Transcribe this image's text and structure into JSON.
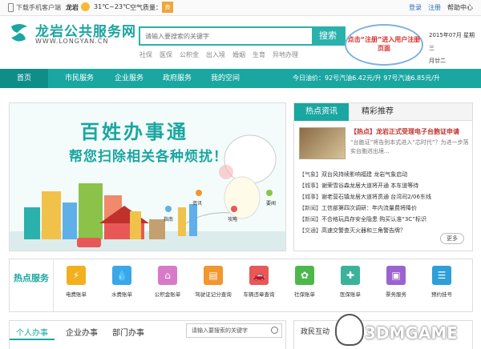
{
  "topbar": {
    "mobile": "下载手机客户端",
    "city": "龙岩",
    "temp": "31℃~23℃",
    "aq_label": "空气质量：",
    "aq_value": "良",
    "links": [
      "登录",
      "注册",
      "帮助中心"
    ]
  },
  "header": {
    "logo_cn": "龙岩公共服务网",
    "logo_en": "WWW.LONGYAN.CN",
    "search_placeholder": "请输入要搜索的关键字",
    "search_btn": "搜索",
    "hot": [
      "社保",
      "医保",
      "公积金",
      "出入境",
      "婚姻",
      "生育",
      "异地办理"
    ],
    "callout": "点击“注册”进入用户注册页面",
    "date": [
      "2015年07月 星期三",
      "月廿二"
    ]
  },
  "nav": {
    "items": [
      "首页",
      "市民服务",
      "企业服务",
      "政府服务",
      "我的空间"
    ],
    "ticker": "今日油价：92号汽油6.42元/升   97号汽油6.85元/升"
  },
  "banner": {
    "title": "百姓办事通",
    "subtitle": "帮您扫除相关各种烦扰！",
    "tags": [
      "资讯",
      "指南",
      "攻略",
      "要闻"
    ]
  },
  "news": {
    "tabs": [
      "热点资讯",
      "精彩推荐"
    ],
    "lead": "【热点】龙岩正式受理电子台胞证申请",
    "lead_summary": "“台胞证”将告别本式进入“芯时代”？为进一步落实台胞进出境...",
    "items": [
      {
        "k": "【气象】",
        "t": "双台风持续影响福建 龙岩气象启动"
      },
      {
        "k": "【城事】",
        "t": "谢荣雪谷森龙居大道将开通 本车道等待"
      },
      {
        "k": "【城事】",
        "t": "谢老营石镇龙居大道将贯通 台湾司2/06东线"
      },
      {
        "k": "【新闻】",
        "t": "工信部第四次调研：年内流量费将降价"
      },
      {
        "k": "【新闻】",
        "t": "不合格玩具存安全隐患 购买认准“3C”标识"
      },
      {
        "k": "【交通】",
        "t": "高速交警查灭火器和三角警告牌？"
      }
    ],
    "more": "更多"
  },
  "services": {
    "label": "热点服务",
    "items": [
      {
        "label": "电费账单",
        "icon": "lightning-icon",
        "color": "#f2b01e",
        "glyph": "⚡"
      },
      {
        "label": "水费账单",
        "icon": "water-drop-icon",
        "color": "#3aa7e8",
        "glyph": "💧"
      },
      {
        "label": "公积金账单",
        "icon": "house-icon",
        "color": "#d77bc8",
        "glyph": "⌂"
      },
      {
        "label": "驾驶证记分查询",
        "icon": "license-icon",
        "color": "#f2962e",
        "glyph": "▤"
      },
      {
        "label": "车辆违章查询",
        "icon": "car-icon",
        "color": "#e85858",
        "glyph": "🚗"
      },
      {
        "label": "社保账单",
        "icon": "flower-icon",
        "color": "#4cb84c",
        "glyph": "✿"
      },
      {
        "label": "医保账单",
        "icon": "medkit-icon",
        "color": "#3bb39a",
        "glyph": "✚"
      },
      {
        "label": "票务服务",
        "icon": "ticket-icon",
        "color": "#9b63cf",
        "glyph": "▣"
      },
      {
        "label": "预约挂号",
        "icon": "register-icon",
        "color": "#2e9fd8",
        "glyph": "☰"
      }
    ]
  },
  "bottom": {
    "tabs": [
      "个人办事",
      "企业办事",
      "部门办事"
    ],
    "search_placeholder": "请输入要搜索的关键字",
    "right_title": "政民互动"
  },
  "watermark": "3DMGAME"
}
